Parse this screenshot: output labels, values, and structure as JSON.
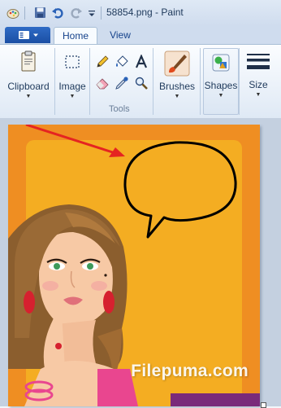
{
  "window": {
    "title": "58854.png - Paint",
    "quick_access": [
      "paint-logo-icon",
      "save-icon",
      "undo-icon",
      "redo-icon",
      "customize-dropdown-icon"
    ]
  },
  "ribbon_tabs": {
    "home": "Home",
    "view": "View"
  },
  "ribbon": {
    "clipboard_label": "Clipboard",
    "image_label": "Image",
    "tools_label": "Tools",
    "brushes_label": "Brushes",
    "shapes_label": "Shapes",
    "size_label": "Size",
    "tools": [
      "pencil-icon",
      "fill-icon",
      "text-icon",
      "eraser-icon",
      "color-picker-icon",
      "magnifier-icon"
    ]
  },
  "canvas": {
    "image_name": "58854.png",
    "watermark": "Filepuma.com",
    "background_color": "#ef8e22",
    "panel_color": "#f4ad22",
    "arrow_color": "#e52421",
    "bubble_color": "#000000"
  }
}
